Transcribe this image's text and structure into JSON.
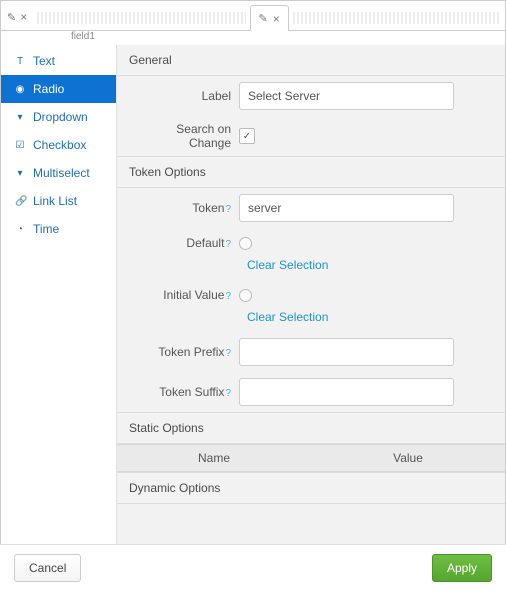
{
  "tabs": {
    "field_label": "field1"
  },
  "sidebar": {
    "items": [
      {
        "icon": "T",
        "label": "Text"
      },
      {
        "icon": "◉",
        "label": "Radio"
      },
      {
        "icon": "▾",
        "label": "Dropdown"
      },
      {
        "icon": "☑",
        "label": "Checkbox"
      },
      {
        "icon": "▾",
        "label": "Multiselect"
      },
      {
        "icon": "🔗",
        "label": "Link List"
      },
      {
        "icon": "◔",
        "label": "Time"
      }
    ]
  },
  "sections": {
    "general": "General",
    "token_options": "Token Options",
    "static_options": "Static Options",
    "dynamic_options": "Dynamic Options"
  },
  "labels": {
    "label": "Label",
    "search_on_change": "Search on Change",
    "token": "Token",
    "default": "Default",
    "initial_value": "Initial Value",
    "token_prefix": "Token Prefix",
    "token_suffix": "Token Suffix",
    "help": "?"
  },
  "values": {
    "label": "Select Server",
    "search_on_change": true,
    "token": "server",
    "token_prefix": "",
    "token_suffix": ""
  },
  "links": {
    "clear_selection": "Clear Selection"
  },
  "table": {
    "col_name": "Name",
    "col_value": "Value"
  },
  "footer": {
    "cancel": "Cancel",
    "apply": "Apply"
  }
}
